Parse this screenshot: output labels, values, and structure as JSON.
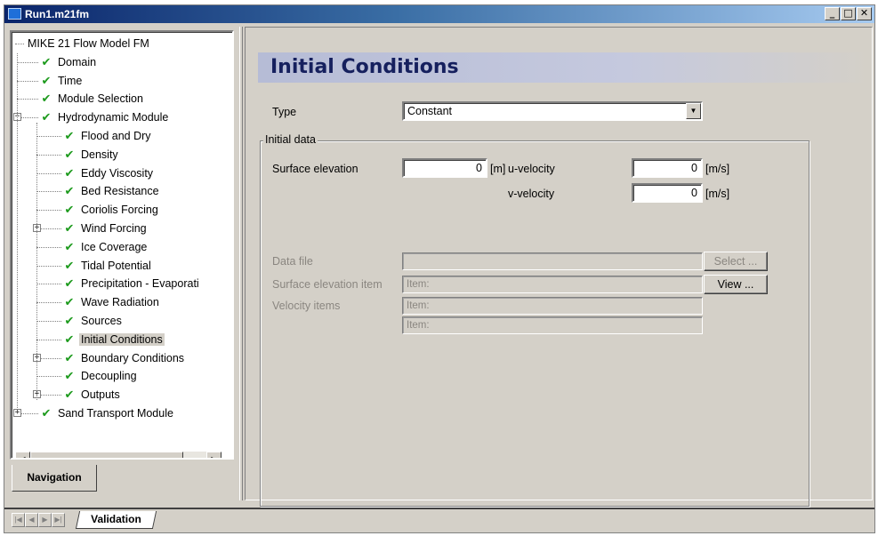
{
  "window": {
    "title": "Run1.m21fm",
    "controls": [
      "_",
      "□",
      "✕"
    ]
  },
  "navigation": {
    "tab_label": "Navigation",
    "tree": [
      {
        "label": "MIKE 21 Flow Model FM",
        "level": 0,
        "checked": false,
        "expander": ""
      },
      {
        "label": "Domain",
        "level": 1,
        "checked": true,
        "expander": ""
      },
      {
        "label": "Time",
        "level": 1,
        "checked": true,
        "expander": ""
      },
      {
        "label": "Module Selection",
        "level": 1,
        "checked": true,
        "expander": ""
      },
      {
        "label": "Hydrodynamic Module",
        "level": 1,
        "checked": true,
        "expander": "minus"
      },
      {
        "label": "Flood and Dry",
        "level": 2,
        "checked": true,
        "expander": ""
      },
      {
        "label": "Density",
        "level": 2,
        "checked": true,
        "expander": ""
      },
      {
        "label": "Eddy Viscosity",
        "level": 2,
        "checked": true,
        "expander": ""
      },
      {
        "label": "Bed Resistance",
        "level": 2,
        "checked": true,
        "expander": ""
      },
      {
        "label": "Coriolis Forcing",
        "level": 2,
        "checked": true,
        "expander": ""
      },
      {
        "label": "Wind Forcing",
        "level": 2,
        "checked": true,
        "expander": "plus"
      },
      {
        "label": "Ice Coverage",
        "level": 2,
        "checked": true,
        "expander": ""
      },
      {
        "label": "Tidal Potential",
        "level": 2,
        "checked": true,
        "expander": ""
      },
      {
        "label": "Precipitation - Evaporati",
        "level": 2,
        "checked": true,
        "expander": ""
      },
      {
        "label": "Wave Radiation",
        "level": 2,
        "checked": true,
        "expander": ""
      },
      {
        "label": "Sources",
        "level": 2,
        "checked": true,
        "expander": ""
      },
      {
        "label": "Initial Conditions",
        "level": 2,
        "checked": true,
        "expander": "",
        "selected": true
      },
      {
        "label": "Boundary Conditions",
        "level": 2,
        "checked": true,
        "expander": "plus"
      },
      {
        "label": "Decoupling",
        "level": 2,
        "checked": true,
        "expander": ""
      },
      {
        "label": "Outputs",
        "level": 2,
        "checked": true,
        "expander": "plus"
      },
      {
        "label": "Sand Transport Module",
        "level": 1,
        "checked": true,
        "expander": "plus"
      }
    ]
  },
  "panel": {
    "heading": "Initial Conditions",
    "type_label": "Type",
    "type_value": "Constant",
    "group_title": "Initial data",
    "surface_elevation_label": "Surface elevation",
    "surface_elevation_value": "0",
    "surface_elevation_unit": "[m]",
    "u_velocity_label": "u-velocity",
    "u_velocity_value": "0",
    "u_velocity_unit": "[m/s]",
    "v_velocity_label": "v-velocity",
    "v_velocity_value": "0",
    "v_velocity_unit": "[m/s]",
    "data_file_label": "Data file",
    "data_file_value": "",
    "select_button": "Select ...",
    "surface_elevation_item_label": "Surface elevation item",
    "surface_elevation_item_value": "Item:",
    "view_button": "View ...",
    "velocity_items_label": "Velocity items",
    "velocity_item_1": "Item:",
    "velocity_item_2": "Item:"
  },
  "bottom": {
    "tab_label": "Validation"
  },
  "colors": {
    "check": "#1c9a1c",
    "titlebar": "#0a246a",
    "face": "#d4d0c8",
    "heading_text": "#16205e"
  }
}
